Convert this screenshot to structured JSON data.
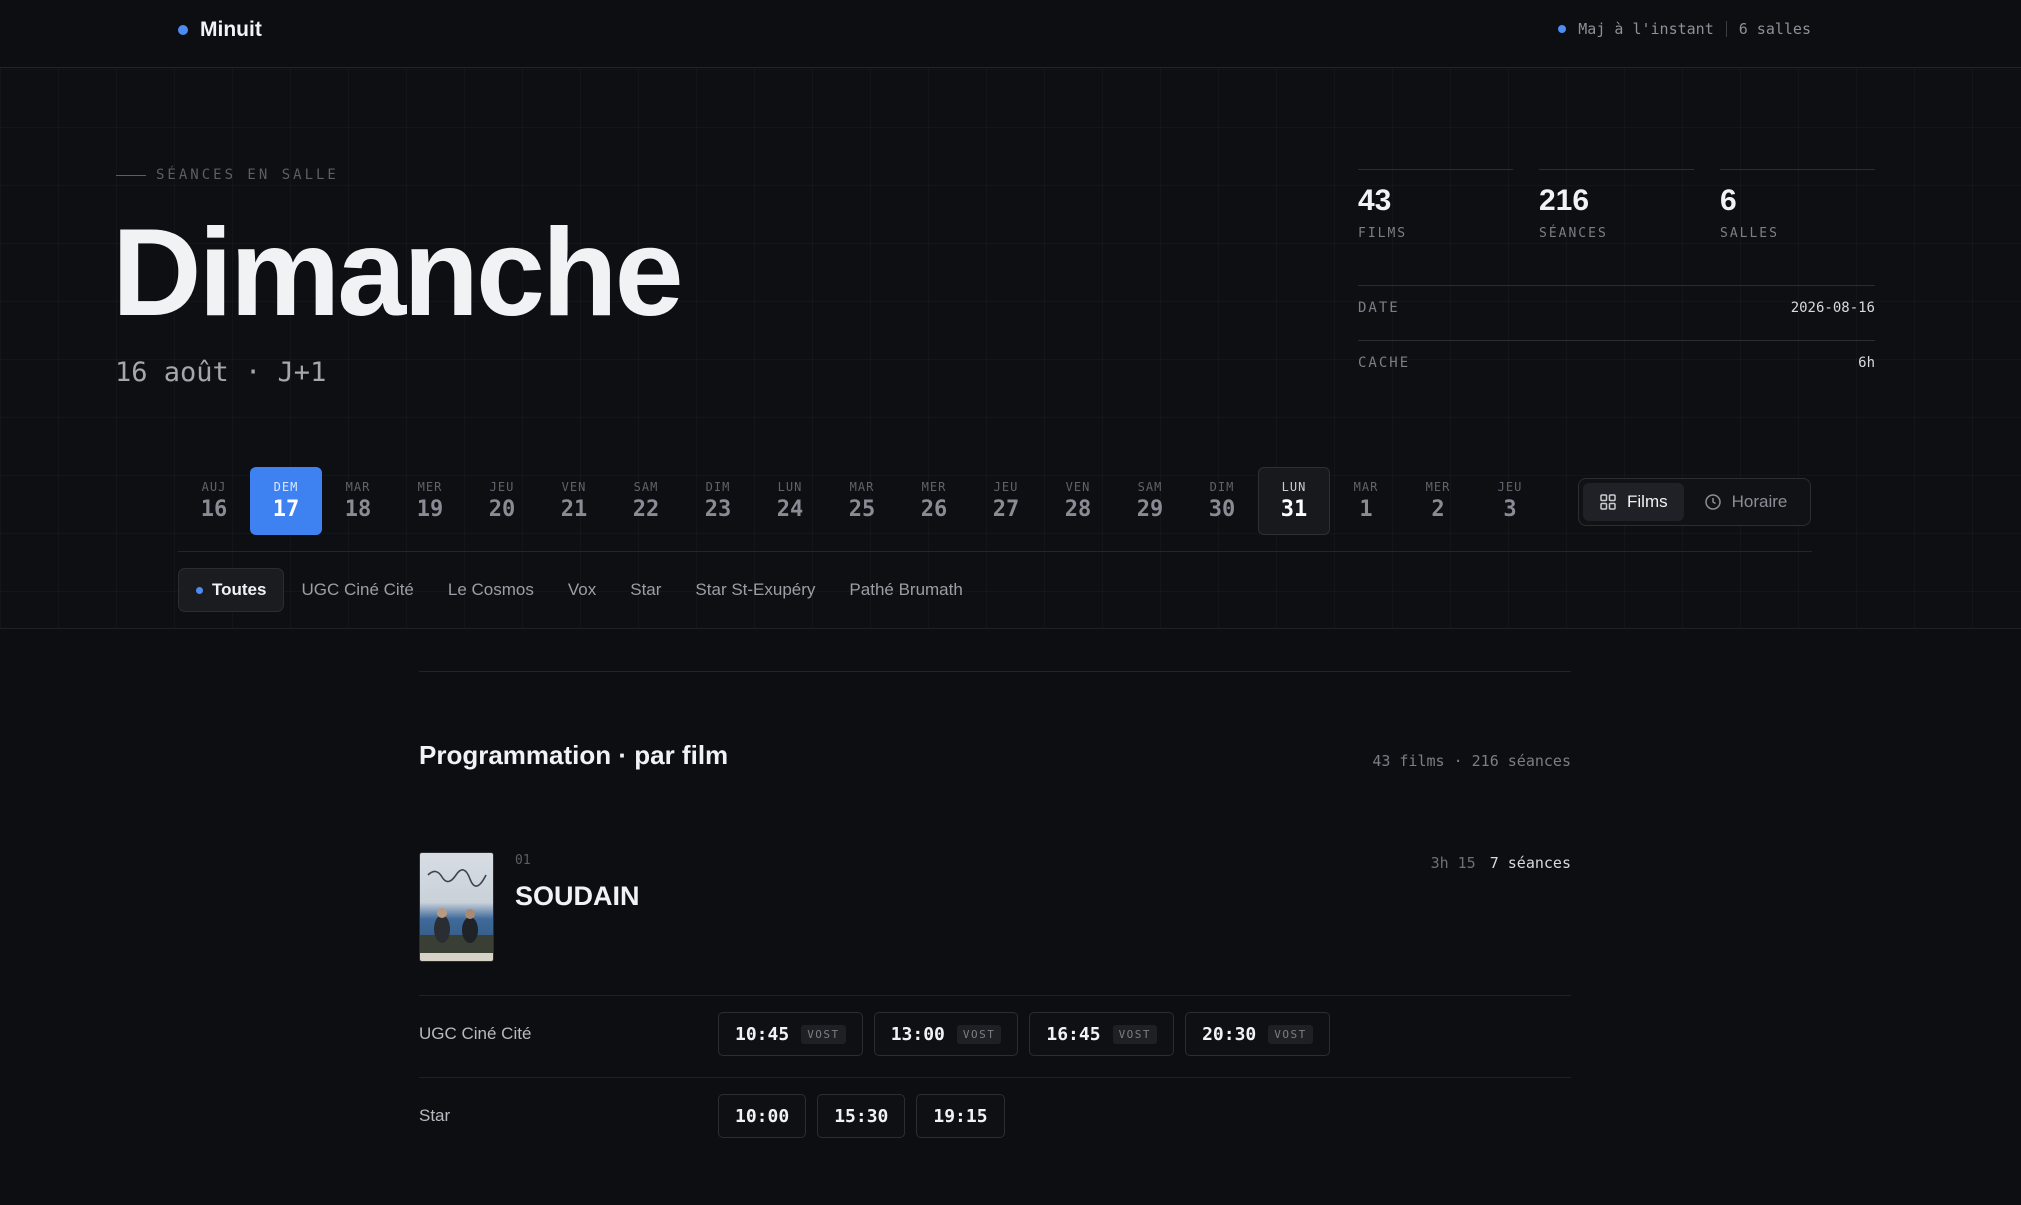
{
  "brand": {
    "name": "Minuit"
  },
  "status": {
    "updated": "Maj à l'instant",
    "venues": "6 salles"
  },
  "hero": {
    "eyebrow": "SÉANCES EN SALLE",
    "day": "Dimanche",
    "subdate": "16 août · J+1"
  },
  "stats": [
    {
      "value": "43",
      "label": "FILMS"
    },
    {
      "value": "216",
      "label": "SÉANCES"
    },
    {
      "value": "6",
      "label": "SALLES"
    }
  ],
  "meta": {
    "date_label": "DATE",
    "date_value": "2026-08-16",
    "cache_label": "CACHE",
    "cache_value": "6h"
  },
  "dates": [
    {
      "dn": "AUJ",
      "dd": "16",
      "state": ""
    },
    {
      "dn": "DEM",
      "dd": "17",
      "state": "active"
    },
    {
      "dn": "MAR",
      "dd": "18",
      "state": ""
    },
    {
      "dn": "MER",
      "dd": "19",
      "state": ""
    },
    {
      "dn": "JEU",
      "dd": "20",
      "state": ""
    },
    {
      "dn": "VEN",
      "dd": "21",
      "state": ""
    },
    {
      "dn": "SAM",
      "dd": "22",
      "state": ""
    },
    {
      "dn": "DIM",
      "dd": "23",
      "state": ""
    },
    {
      "dn": "LUN",
      "dd": "24",
      "state": ""
    },
    {
      "dn": "MAR",
      "dd": "25",
      "state": ""
    },
    {
      "dn": "MER",
      "dd": "26",
      "state": ""
    },
    {
      "dn": "JEU",
      "dd": "27",
      "state": ""
    },
    {
      "dn": "VEN",
      "dd": "28",
      "state": ""
    },
    {
      "dn": "SAM",
      "dd": "29",
      "state": ""
    },
    {
      "dn": "DIM",
      "dd": "30",
      "state": ""
    },
    {
      "dn": "LUN",
      "dd": "31",
      "state": "boxed"
    },
    {
      "dn": "MAR",
      "dd": "1",
      "state": ""
    },
    {
      "dn": "MER",
      "dd": "2",
      "state": ""
    },
    {
      "dn": "JEU",
      "dd": "3",
      "state": ""
    }
  ],
  "view": {
    "films": "Films",
    "schedule": "Horaire"
  },
  "cinemas": [
    {
      "label": "Toutes",
      "on": true
    },
    {
      "label": "UGC Ciné Cité",
      "on": false
    },
    {
      "label": "Le Cosmos",
      "on": false
    },
    {
      "label": "Vox",
      "on": false
    },
    {
      "label": "Star",
      "on": false
    },
    {
      "label": "Star St-Exupéry",
      "on": false
    },
    {
      "label": "Pathé Brumath",
      "on": false
    }
  ],
  "section": {
    "title": "Programmation · par film",
    "count": "43 films · 216 séances"
  },
  "film": {
    "index": "01",
    "title": "SOUDAIN",
    "duration": "3h 15",
    "sessions": "7 séances",
    "venues": [
      {
        "name": "UGC Ciné Cité",
        "times": [
          {
            "t": "10:45",
            "tag": "VOST"
          },
          {
            "t": "13:00",
            "tag": "VOST"
          },
          {
            "t": "16:45",
            "tag": "VOST"
          },
          {
            "t": "20:30",
            "tag": "VOST"
          }
        ]
      },
      {
        "name": "Star",
        "times": [
          {
            "t": "10:00",
            "tag": ""
          },
          {
            "t": "15:30",
            "tag": ""
          },
          {
            "t": "19:15",
            "tag": ""
          }
        ]
      }
    ]
  },
  "colors": {
    "accent": "#3d82f0",
    "background": "#0d0e11"
  }
}
